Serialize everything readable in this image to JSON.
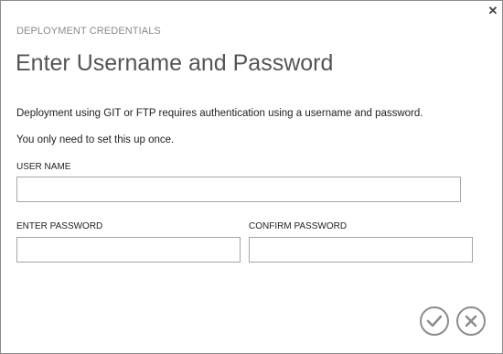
{
  "dialog": {
    "section_label": "DEPLOYMENT CREDENTIALS",
    "title": "Enter Username and Password",
    "description": "Deployment using GIT or FTP requires authentication using a username and password.",
    "note": "You only need to set this up once.",
    "close_icon": "close-icon"
  },
  "fields": {
    "username": {
      "label": "USER NAME",
      "value": "",
      "placeholder": ""
    },
    "password": {
      "label": "ENTER PASSWORD",
      "value": "",
      "placeholder": ""
    },
    "confirm": {
      "label": "CONFIRM PASSWORD",
      "value": "",
      "placeholder": ""
    }
  },
  "actions": {
    "ok_icon": "checkmark-icon",
    "cancel_icon": "close-icon"
  },
  "colors": {
    "border": "#8c8c8c",
    "input_border": "#a6a6a6",
    "title": "#555555",
    "muted": "#8a8a8a"
  }
}
